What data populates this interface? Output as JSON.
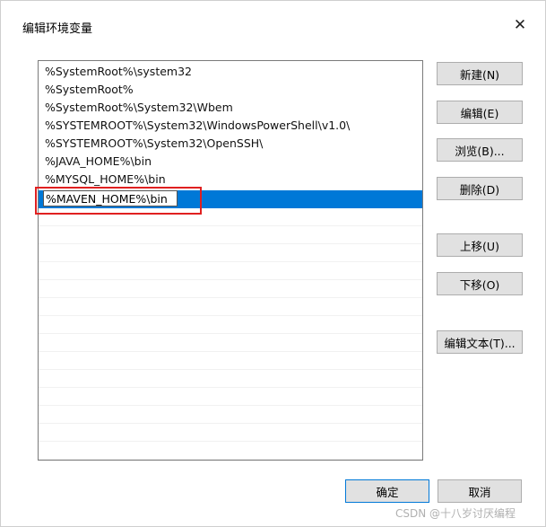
{
  "window": {
    "title": "编辑环境变量",
    "close_glyph": "✕"
  },
  "list": {
    "items": [
      "%SystemRoot%\\system32",
      "%SystemRoot%",
      "%SystemRoot%\\System32\\Wbem",
      "%SYSTEMROOT%\\System32\\WindowsPowerShell\\v1.0\\",
      "%SYSTEMROOT%\\System32\\OpenSSH\\",
      "%JAVA_HOME%\\bin",
      "%MYSQL_HOME%\\bin"
    ],
    "editing_value": "%MAVEN_HOME%\\bin"
  },
  "buttons": {
    "new": "新建(N)",
    "edit": "编辑(E)",
    "browse": "浏览(B)...",
    "delete": "删除(D)",
    "move_up": "上移(U)",
    "move_down": "下移(O)",
    "edit_text": "编辑文本(T)...",
    "ok": "确定",
    "cancel": "取消"
  },
  "watermark": "CSDN @十八岁讨厌编程",
  "colors": {
    "selection": "#0078d7",
    "highlight_box": "#e02020"
  }
}
